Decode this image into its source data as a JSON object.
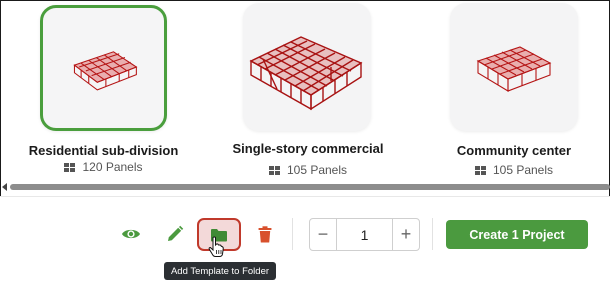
{
  "templates": [
    {
      "title": "Residential sub-division",
      "panels": "120 Panels",
      "selected": true
    },
    {
      "title": "Single-story commercial",
      "panels": "105 Panels",
      "selected": false
    },
    {
      "title": "Community center",
      "panels": "105 Panels",
      "selected": false
    }
  ],
  "toolbar": {
    "icons": [
      "eye-icon",
      "pencil-icon",
      "folder-icon",
      "trash-icon"
    ],
    "tooltip": "Add Template to Folder"
  },
  "quantity": {
    "value": "1",
    "minus": "−",
    "plus": "+"
  },
  "create_button": "Create 1 Project",
  "colors": {
    "accent_green": "#4b9a3f",
    "selected_border": "#4a9e3d",
    "model_red": "#b51515",
    "highlight_red": "#c0392b"
  }
}
